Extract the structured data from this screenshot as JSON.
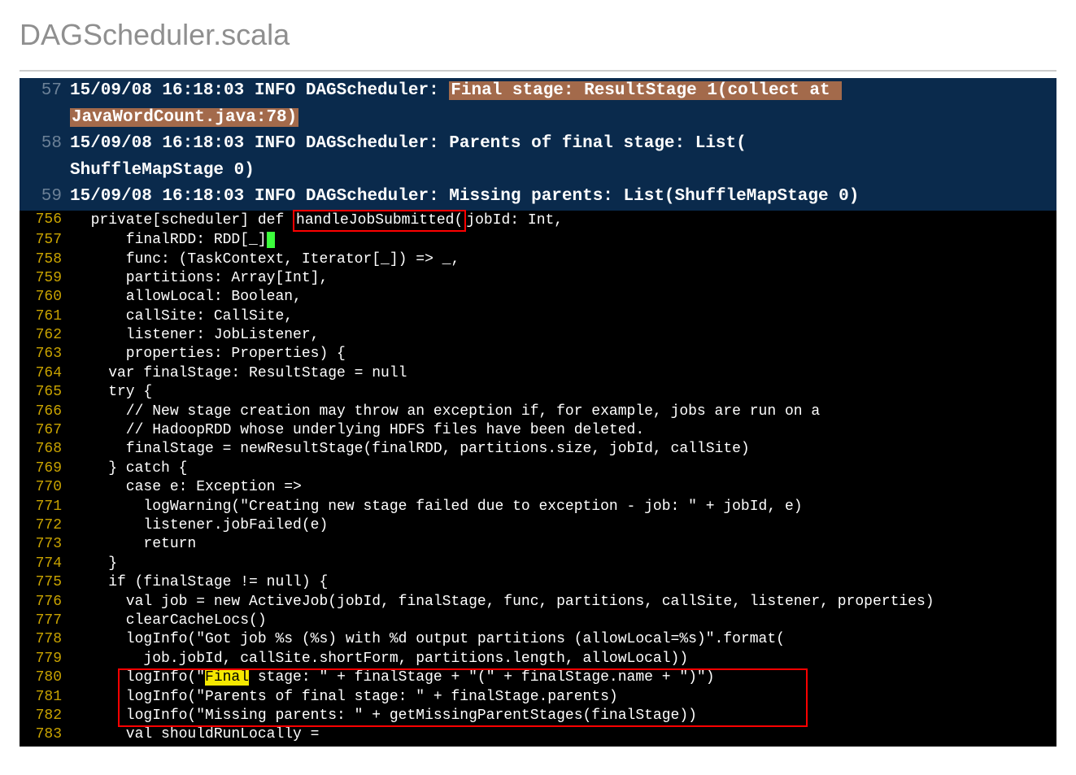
{
  "title": "DAGScheduler.scala",
  "log": {
    "rows": [
      {
        "ln": "57",
        "prefix": "15/09/08 16:18:03 INFO DAGScheduler: ",
        "hl1": "Final stage: ResultStage 1(collect at ",
        "wrap_indent": "",
        "hl2": "JavaWordCount.java:78)"
      },
      {
        "ln": "58",
        "text": "15/09/08 16:18:03 INFO DAGScheduler: Parents of final stage: List(",
        "wrap_indent": "",
        "wrap_text": "ShuffleMapStage 0)"
      },
      {
        "ln": "59",
        "text": "15/09/08 16:18:03 INFO DAGScheduler: Missing parents: List(ShuffleMapStage 0)"
      }
    ]
  },
  "code": {
    "lines": [
      {
        "ln": "756",
        "pre": "  private[scheduler] def ",
        "box": "handleJobSubmitted(",
        "post": "jobId: Int,"
      },
      {
        "ln": "757",
        "pre": "      finalRDD: RDD[_]",
        "cursor": ",",
        "post": ""
      },
      {
        "ln": "758",
        "text": "      func: (TaskContext, Iterator[_]) => _,"
      },
      {
        "ln": "759",
        "text": "      partitions: Array[Int],"
      },
      {
        "ln": "760",
        "text": "      allowLocal: Boolean,"
      },
      {
        "ln": "761",
        "text": "      callSite: CallSite,"
      },
      {
        "ln": "762",
        "text": "      listener: JobListener,"
      },
      {
        "ln": "763",
        "text": "      properties: Properties) {"
      },
      {
        "ln": "764",
        "text": "    var finalStage: ResultStage = null"
      },
      {
        "ln": "765",
        "text": "    try {"
      },
      {
        "ln": "766",
        "text": "      // New stage creation may throw an exception if, for example, jobs are run on a"
      },
      {
        "ln": "767",
        "text": "      // HadoopRDD whose underlying HDFS files have been deleted."
      },
      {
        "ln": "768",
        "text": "      finalStage = newResultStage(finalRDD, partitions.size, jobId, callSite)"
      },
      {
        "ln": "769",
        "text": "    } catch {"
      },
      {
        "ln": "770",
        "text": "      case e: Exception =>"
      },
      {
        "ln": "771",
        "text": "        logWarning(\"Creating new stage failed due to exception - job: \" + jobId, e)"
      },
      {
        "ln": "772",
        "text": "        listener.jobFailed(e)"
      },
      {
        "ln": "773",
        "text": "        return"
      },
      {
        "ln": "774",
        "text": "    }"
      },
      {
        "ln": "775",
        "text": "    if (finalStage != null) {"
      },
      {
        "ln": "776",
        "text": "      val job = new ActiveJob(jobId, finalStage, func, partitions, callSite, listener, properties)"
      },
      {
        "ln": "777",
        "text": "      clearCacheLocs()"
      },
      {
        "ln": "778",
        "text": "      logInfo(\"Got job %s (%s) with %d output partitions (allowLocal=%s)\".format("
      },
      {
        "ln": "779",
        "text": "        job.jobId, callSite.shortForm, partitions.length, allowLocal))"
      },
      {
        "ln": "780",
        "pre": "      logInfo(\"",
        "yellow": "Final",
        "post": " stage: \" + finalStage + \"(\" + finalStage.name + \")\")",
        "boxstart": true
      },
      {
        "ln": "781",
        "text": "      logInfo(\"Parents of final stage: \" + finalStage.parents)"
      },
      {
        "ln": "782",
        "text": "      logInfo(\"Missing parents: \" + getMissingParentStages(finalStage))"
      },
      {
        "ln": "783",
        "text": "      val shouldRunLocally ="
      }
    ]
  }
}
